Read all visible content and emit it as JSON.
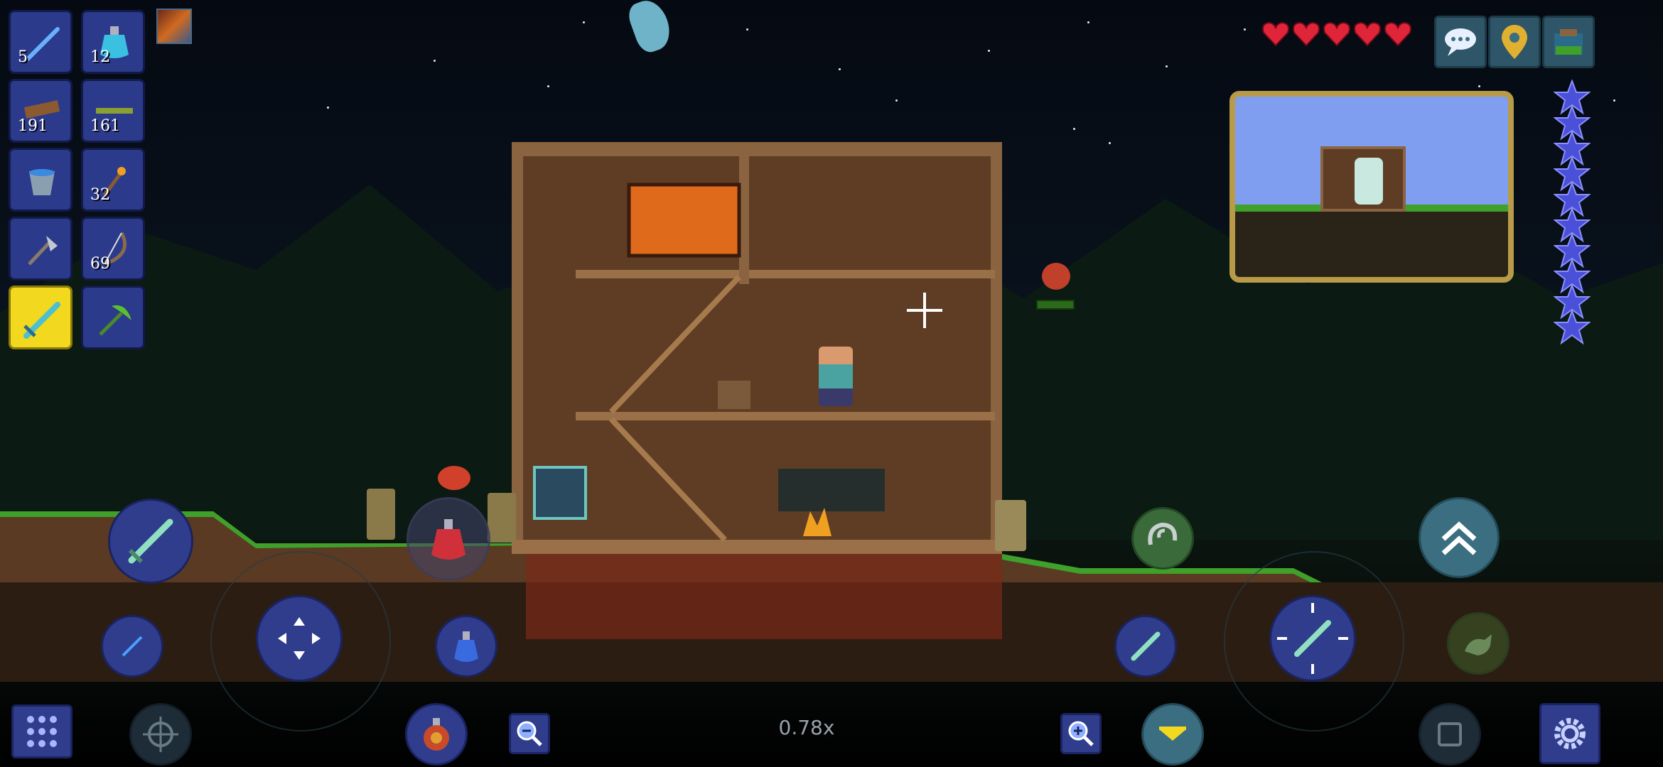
{
  "hotbar": {
    "slots": [
      {
        "item": "enchanted-sword-icon",
        "count": "5"
      },
      {
        "item": "mana-potion-icon",
        "count": "12"
      },
      {
        "item": "wood-icon",
        "count": "191"
      },
      {
        "item": "wood-platform-icon",
        "count": "161"
      },
      {
        "item": "bucket-icon",
        "count": ""
      },
      {
        "item": "torch-icon",
        "count": "32"
      },
      {
        "item": "copper-axe-icon",
        "count": ""
      },
      {
        "item": "wooden-bow-icon",
        "count": "69"
      },
      {
        "item": "terra-blade-icon",
        "count": "",
        "selected": true
      },
      {
        "item": "leaf-pickaxe-icon",
        "count": ""
      }
    ]
  },
  "buff": {
    "icon": "campfire-buff-icon"
  },
  "status": {
    "health_hearts": 5,
    "mana_stars": 10
  },
  "top_buttons": [
    "chat-icon",
    "map-pin-icon",
    "housing-icon"
  ],
  "zoom_level": "0.78x",
  "colors": {
    "hotbar_slot": "#2c3a8c",
    "selected_slot": "#f2d81e",
    "heart": "#e0243a",
    "star": "#4a50d8"
  }
}
